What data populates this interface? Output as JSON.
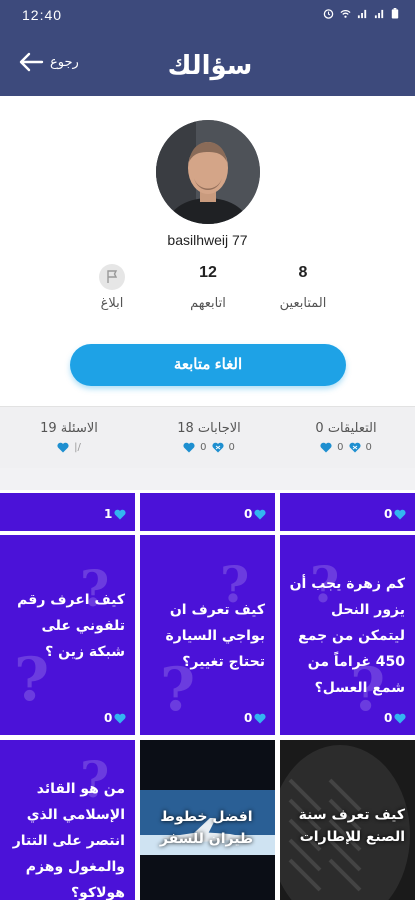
{
  "status": {
    "time": "12:40"
  },
  "header": {
    "back_label": "رجوع",
    "logo_text": "سؤالك"
  },
  "profile": {
    "username": "basilhweij 77",
    "stats": [
      {
        "count": "8",
        "label": "المتابعين"
      },
      {
        "count": "12",
        "label": "اتابعهم"
      },
      {
        "count": "",
        "label": "ابلاغ"
      }
    ],
    "unfollow_label": "الغاء متابعة"
  },
  "tabs": [
    {
      "label": "التعليقات 0",
      "meta_a": "0",
      "meta_b": "0"
    },
    {
      "label": "الاجابات 18",
      "meta_a": "0",
      "meta_b": "0"
    },
    {
      "label": "الاسئلة 19",
      "meta_a": "",
      "meta_b": ""
    }
  ],
  "grid": {
    "top_counts": [
      "1",
      "0",
      "0"
    ],
    "questions": [
      {
        "text": "كم زهرة يجب أن يزور النحل ليتمكن من جمع 450 غراماً من شمع العسل؟",
        "count": "0"
      },
      {
        "text": "كيف تعرف ان بواجي السيارة تحتاج تغيير؟",
        "count": "0"
      },
      {
        "text": "كيف اعرف رقم تلفوني على شبكة زين ؟",
        "count": "0"
      },
      {
        "text": "كيف تعرف سنة الصنع للإطارات",
        "count": ""
      },
      {
        "text": "افضل خطوط طيران للسفر",
        "count": ""
      },
      {
        "text": "من هو القائد الإسلامي الذي انتصر على التتار والمغول وهزم هولاكو؟",
        "count": ""
      }
    ]
  },
  "colors": {
    "header": "#3d4a7c",
    "accent": "#1ea2e6",
    "tile": "#4b12d8"
  }
}
